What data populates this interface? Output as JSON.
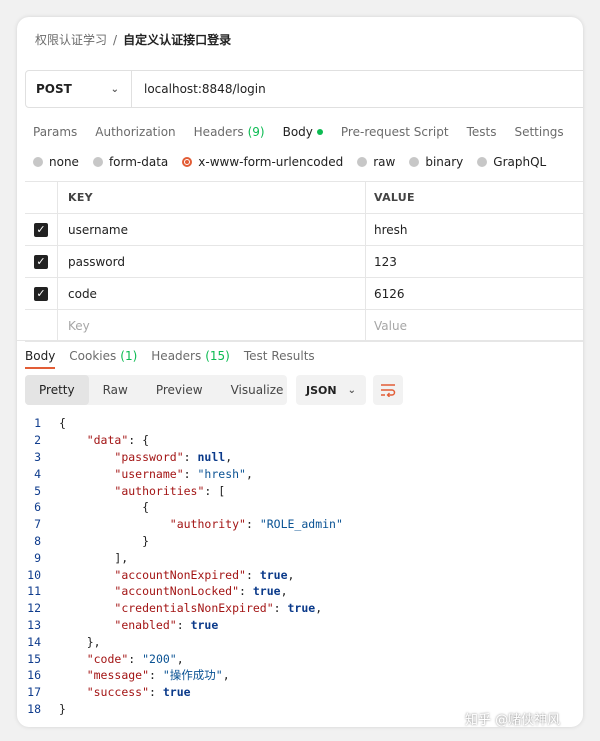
{
  "breadcrumb": {
    "parent": "权限认证学习",
    "separator": "/",
    "current": "自定义认证接口登录"
  },
  "request": {
    "method": "POST",
    "url": "localhost:8848/login"
  },
  "request_tabs": [
    {
      "label": "Params"
    },
    {
      "label": "Authorization"
    },
    {
      "label": "Headers",
      "count": "(9)"
    },
    {
      "label": "Body"
    },
    {
      "label": "Pre-request Script"
    },
    {
      "label": "Tests"
    },
    {
      "label": "Settings"
    }
  ],
  "body_types": [
    "none",
    "form-data",
    "x-www-form-urlencoded",
    "raw",
    "binary",
    "GraphQL"
  ],
  "body_type_selected": "x-www-form-urlencoded",
  "params": {
    "headers": {
      "key": "KEY",
      "value": "VALUE"
    },
    "rows": [
      {
        "key": "username",
        "value": "hresh",
        "checked": true
      },
      {
        "key": "password",
        "value": "123",
        "checked": true
      },
      {
        "key": "code",
        "value": "6126",
        "checked": true
      }
    ],
    "placeholder": {
      "key": "Key",
      "value": "Value"
    }
  },
  "response_tabs": [
    {
      "label": "Body"
    },
    {
      "label": "Cookies",
      "count": "(1)"
    },
    {
      "label": "Headers",
      "count": "(15)"
    },
    {
      "label": "Test Results"
    }
  ],
  "view_modes": [
    "Pretty",
    "Raw",
    "Preview",
    "Visualize"
  ],
  "format": "JSON",
  "code_lines": [
    "{",
    "    \"data\": {",
    "        \"password\": null,",
    "        \"username\": \"hresh\",",
    "        \"authorities\": [",
    "            {",
    "                \"authority\": \"ROLE_admin\"",
    "            }",
    "        ],",
    "        \"accountNonExpired\": true,",
    "        \"accountNonLocked\": true,",
    "        \"credentialsNonExpired\": true,",
    "        \"enabled\": true",
    "    },",
    "    \"code\": \"200\",",
    "    \"message\": \"操作成功\",",
    "    \"success\": true",
    "}"
  ],
  "watermark": "知乎 @赌侠神风",
  "colors": {
    "accent": "#e25d36",
    "green": "#0cbb52"
  }
}
